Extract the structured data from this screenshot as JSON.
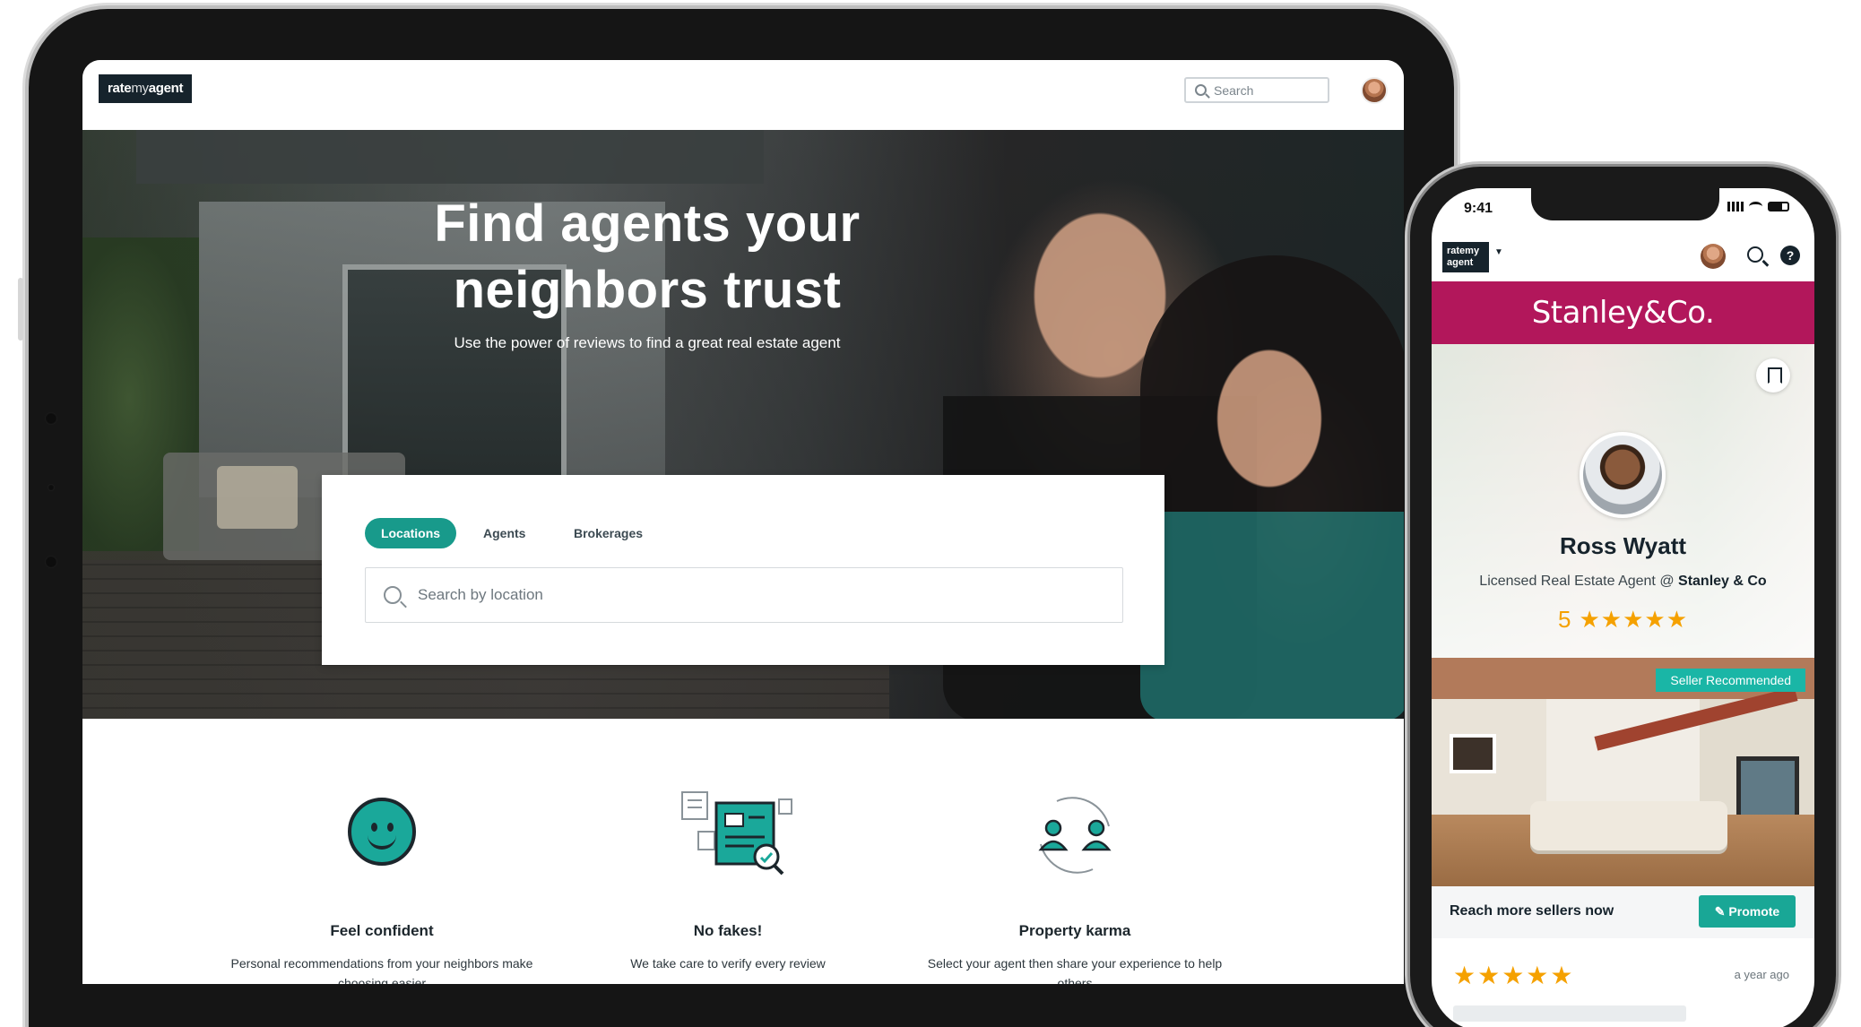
{
  "tablet": {
    "nav": {
      "logo_main": "rate",
      "logo_mid": "my",
      "logo_end": "agent",
      "search_placeholder": "Search"
    },
    "hero": {
      "title_line1": "Find agents your",
      "title_line2": "neighbors trust",
      "subtitle": "Use the power of reviews to find a great real estate agent"
    },
    "search": {
      "tabs": [
        "Locations",
        "Agents",
        "Brokerages"
      ],
      "active_tab": "Locations",
      "placeholder": "Search by location"
    },
    "features": [
      {
        "icon": "smiley-icon",
        "title": "Feel confident",
        "desc": "Personal recommendations from your neighbors make choosing easier"
      },
      {
        "icon": "verified-documents-icon",
        "title": "No fakes!",
        "desc": "We take care to verify every review"
      },
      {
        "icon": "people-exchange-icon",
        "title": "Property karma",
        "desc": "Select your agent then share your experience to help others"
      }
    ]
  },
  "phone": {
    "status_time": "9:41",
    "logo": "ratemy agent",
    "brand": {
      "name": "Stanley&Co.",
      "color": "#b2175b"
    },
    "agent": {
      "name": "Ross Wyatt",
      "role_prefix": "Licensed Real Estate Agent @ ",
      "agency": "Stanley & Co",
      "rating": "5",
      "stars": "★★★★★"
    },
    "badge": "Seller Recommended",
    "promo": {
      "text": "Reach more sellers now",
      "button": "Promote"
    },
    "review": {
      "stars": "★★★★★",
      "age": "a year ago"
    }
  },
  "colors": {
    "accent": "#189a8b",
    "star": "#f5a100",
    "dark": "#16232c"
  }
}
